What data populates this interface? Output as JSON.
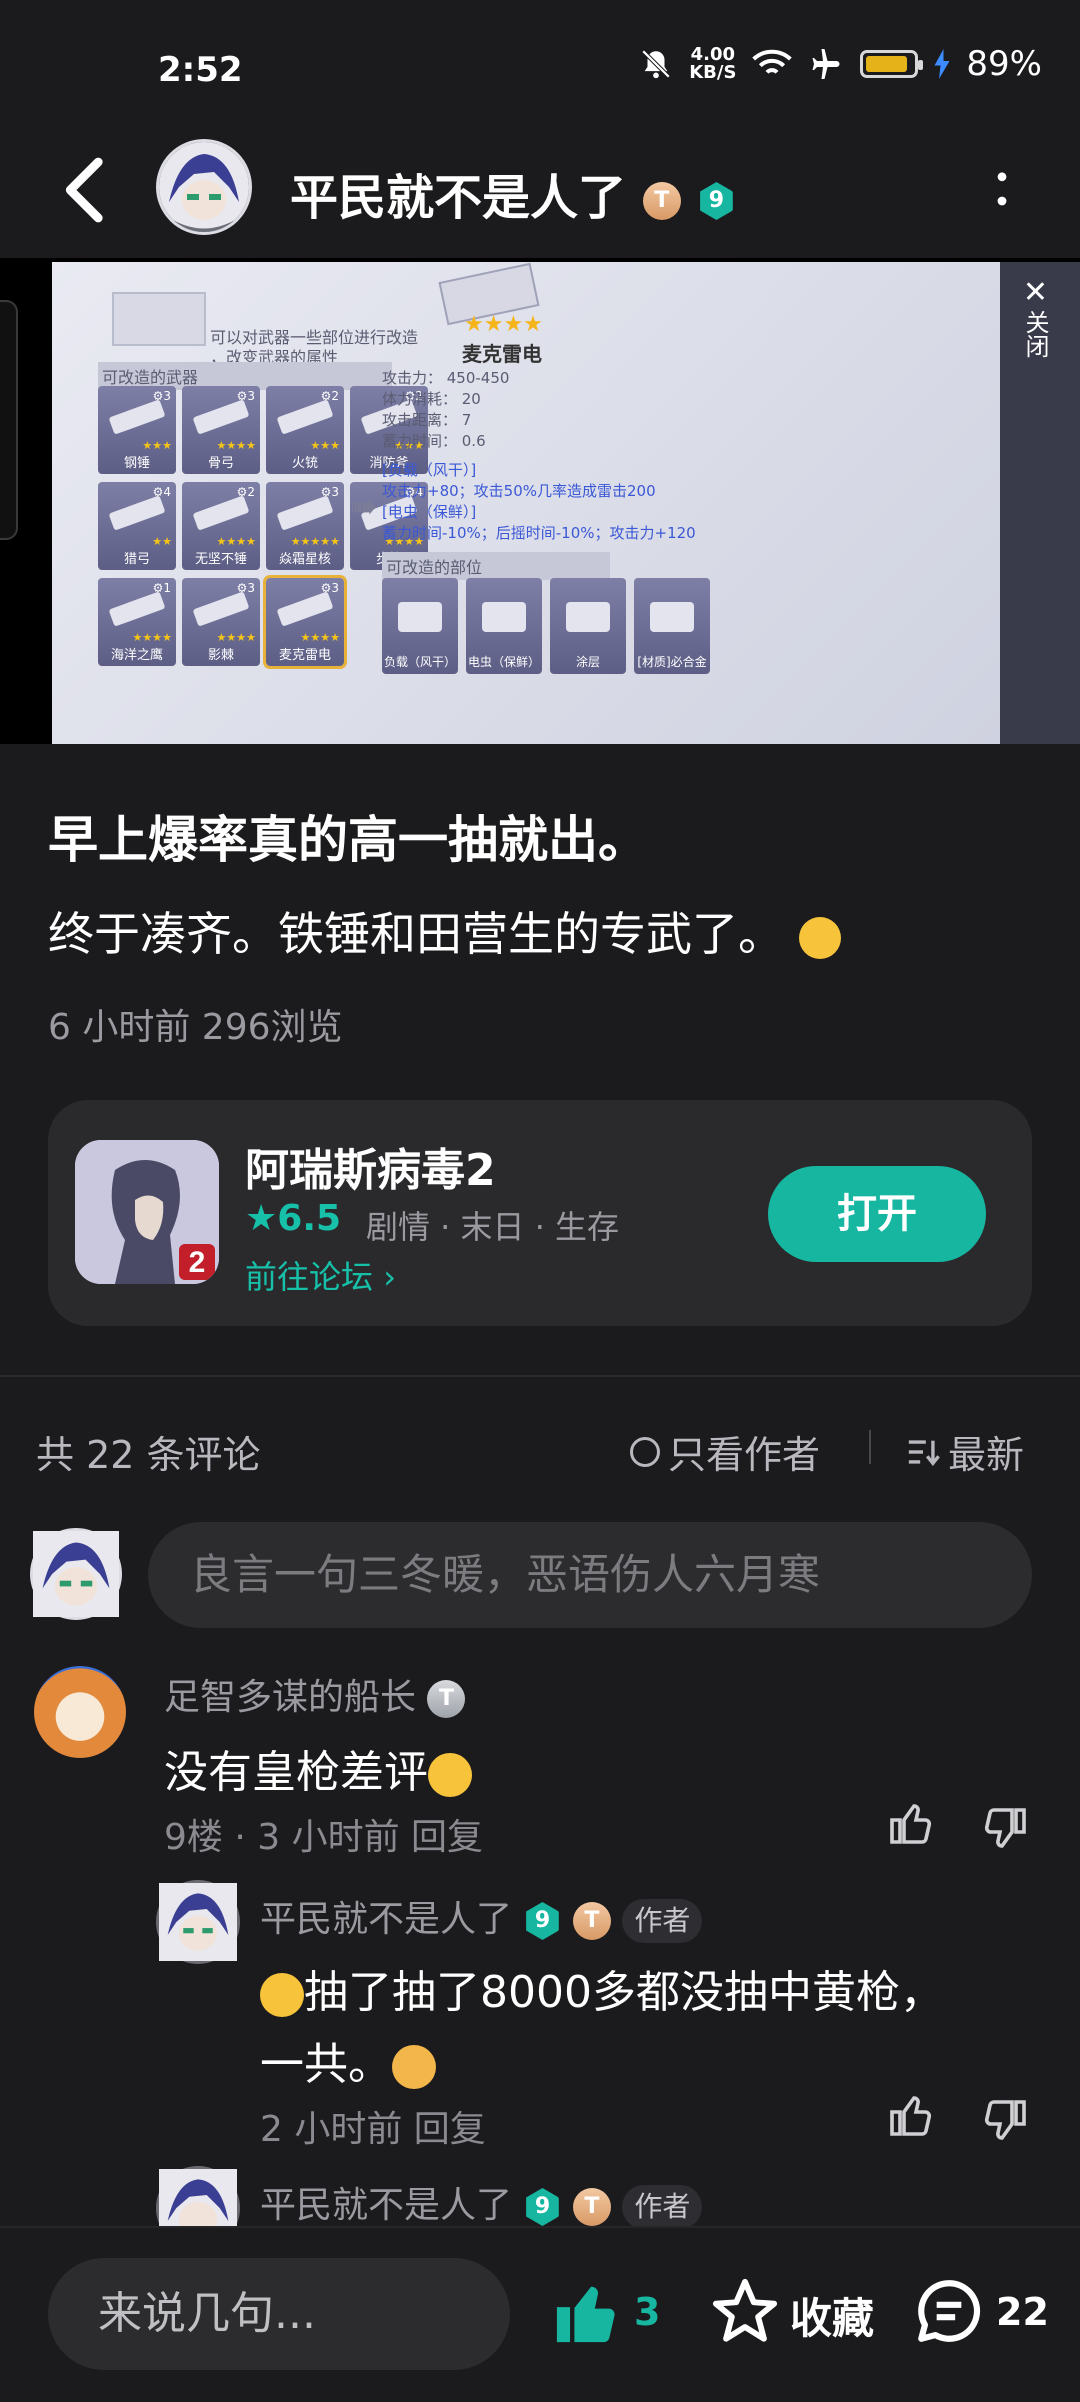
{
  "status_bar": {
    "time": "2:52",
    "net_speed_value": "4.00",
    "net_speed_unit": "KB/S",
    "battery_percent": "89%",
    "battery_level": 0.89
  },
  "header": {
    "username": "平民就不是人了",
    "badge_t": "T",
    "badge_level": "9"
  },
  "screenshot": {
    "close_label": "关闭",
    "modify_hint_line1": "可以对武器一些部位进行改造",
    "modify_hint_line2": "，改变武器的属性",
    "weapons_title": "可改造的武器",
    "weapons": [
      {
        "name": "钢锤",
        "num": "3",
        "stars": "★★★"
      },
      {
        "name": "骨弓",
        "num": "3",
        "stars": "★★★★"
      },
      {
        "name": "火铳",
        "num": "2",
        "stars": "★★★"
      },
      {
        "name": "消防斧",
        "num": "2",
        "stars": "★★★"
      },
      {
        "name": "猎弓",
        "num": "4",
        "stars": "★★"
      },
      {
        "name": "无坚不锤",
        "num": "2",
        "stars": "★★★★"
      },
      {
        "name": "焱霜星核",
        "num": "3",
        "stars": "★★★★★"
      },
      {
        "name": "步枪",
        "num": "4",
        "stars": "★★★★"
      },
      {
        "name": "海洋之鹰",
        "num": "1",
        "stars": "★★★★"
      },
      {
        "name": "影棘",
        "num": "3",
        "stars": "★★★★"
      },
      {
        "name": "麦克雷电",
        "num": "3",
        "stars": "★★★★"
      }
    ],
    "selected_weapon": "麦克雷电",
    "selected_stars": "★★★★",
    "stats": [
      "攻击力： 450-450",
      "体力消耗： 20",
      "攻击距离： 7",
      "蓄力时间： 0.6"
    ],
    "mods": [
      "[负载（风干）]",
      "攻击力+80；攻击50%几率造成雷击200",
      "[电虫（保鲜）]",
      "蓄力时间-10%；后摇时间-10%；攻击力+120"
    ],
    "parts_title": "可改造的部位",
    "parts": [
      "负载（风干）",
      "电虫（保鲜）",
      "涂层",
      "[材质]必合金"
    ]
  },
  "post": {
    "line1": "早上爆率真的高一抽就出。",
    "line2": "终于凑齐。铁锤和田营生的专武了。",
    "meta": "6 小时前  296浏览"
  },
  "app_card": {
    "name": "阿瑞斯病毒2",
    "rating": "6.5",
    "tags": "剧情 · 末日 · 生存",
    "forum_link": "前往论坛",
    "open_button": "打开",
    "icon_badge": "2"
  },
  "comments_header": {
    "count": "共 22 条评论",
    "only_author": "只看作者",
    "sort": "最新"
  },
  "comment_input": {
    "placeholder": "良言一句三冬暖，恶语伤人六月寒"
  },
  "comments": [
    {
      "author": "足智多谋的船长",
      "text": "没有皇枪差评",
      "meta": "9楼 · 3 小时前  回复",
      "badge": "T"
    }
  ],
  "replies": [
    {
      "author": "平民就不是人了",
      "badge_level": "9",
      "badge_t": "T",
      "author_tag": "作者",
      "text_line1": "抽了抽了8000多都没抽中黄枪，",
      "text_line2": "一共。",
      "meta": "2 小时前  回复"
    },
    {
      "author": "平民就不是人了",
      "badge_level": "9",
      "badge_t": "T",
      "author_tag": "作者"
    }
  ],
  "bottom_bar": {
    "input_placeholder": "来说几句...",
    "like_count": "3",
    "favorite_label": "收藏",
    "comment_count": "22"
  },
  "colors": {
    "accent": "#17b6a1",
    "background": "#1b1b1d",
    "card": "#2a2a2c"
  }
}
